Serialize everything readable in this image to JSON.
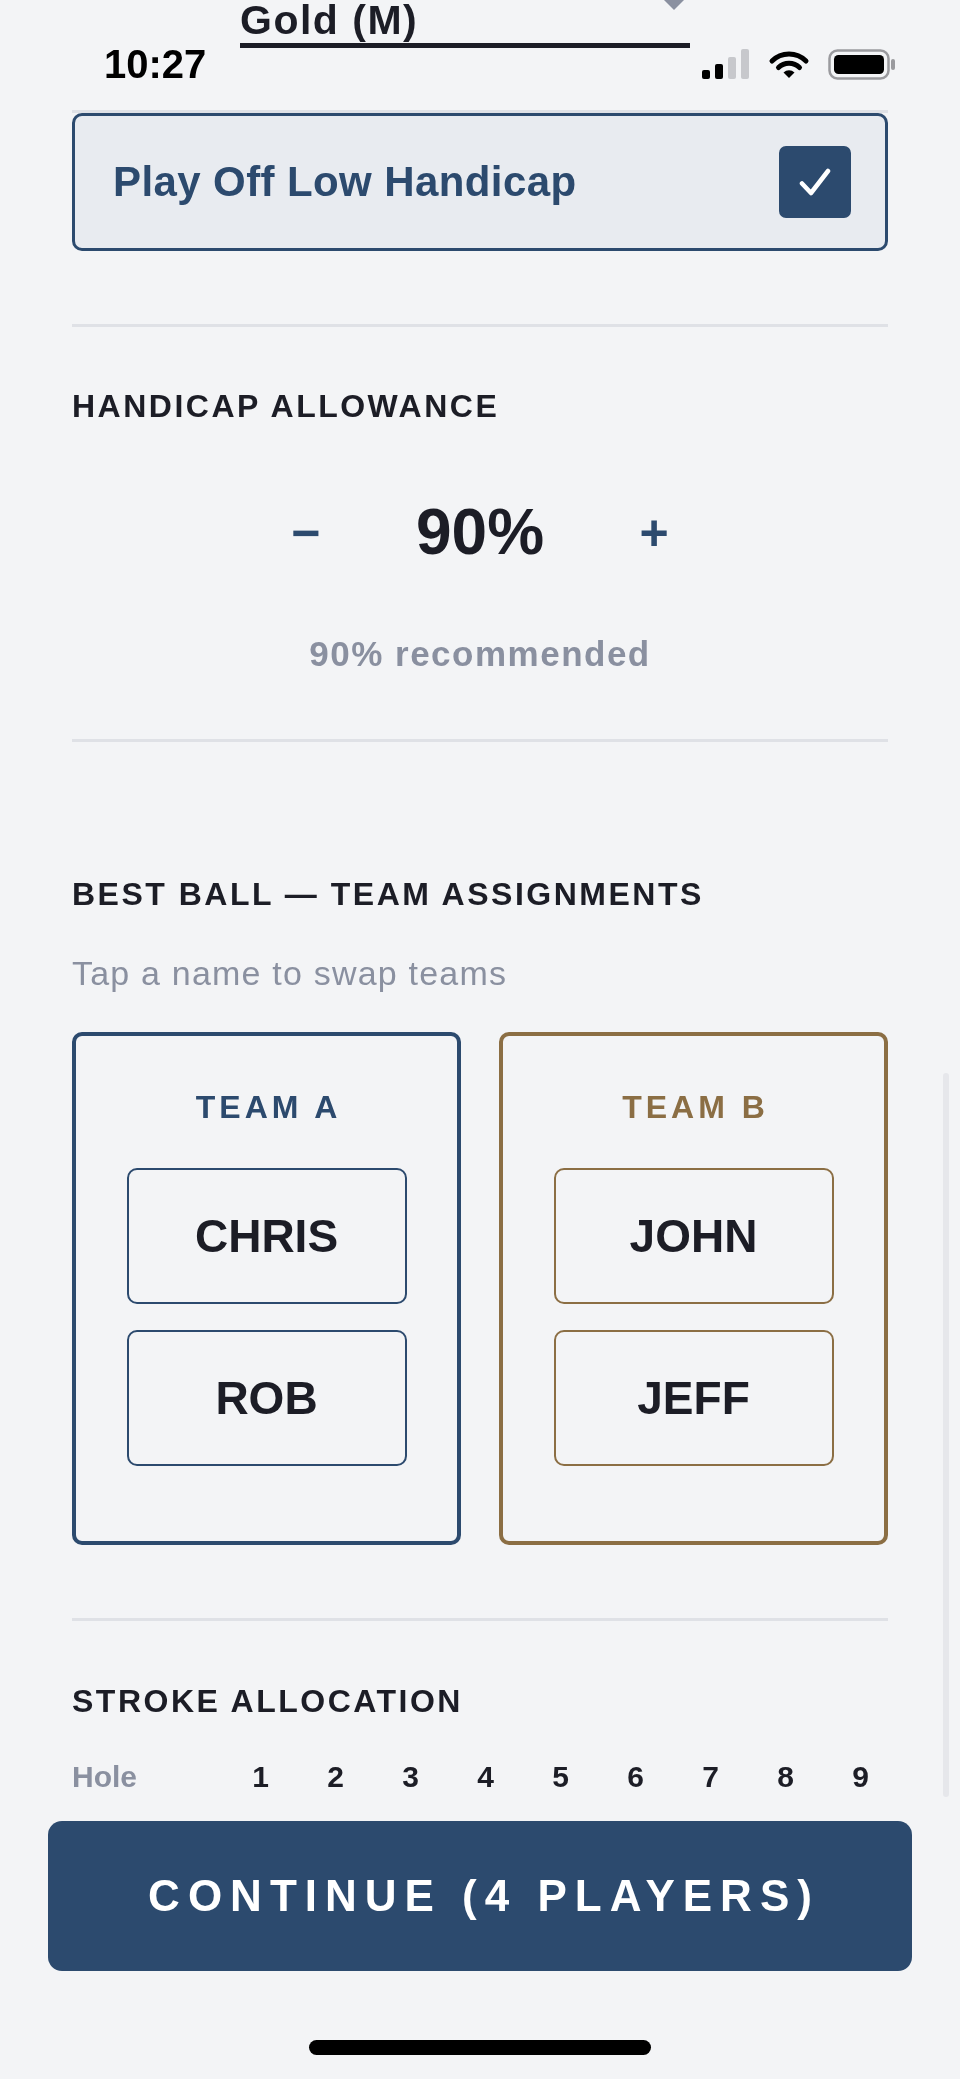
{
  "top_field": {
    "value": "Gold (M)"
  },
  "status_bar": {
    "time": "10:27"
  },
  "play_off_low": {
    "label": "Play Off Low Handicap",
    "checked": true
  },
  "handicap_allowance": {
    "heading": "HANDICAP ALLOWANCE",
    "decrement": "−",
    "value": "90%",
    "increment": "+",
    "note": "90% recommended"
  },
  "teams_section": {
    "heading": "BEST BALL — TEAM ASSIGNMENTS",
    "hint": "Tap a name to swap teams",
    "teams": [
      {
        "name": "TEAM A",
        "color": "#2c4a6e",
        "players": [
          "CHRIS",
          "ROB"
        ]
      },
      {
        "name": "TEAM B",
        "color": "#8b6e44",
        "players": [
          "JOHN",
          "JEFF"
        ]
      }
    ]
  },
  "stroke_allocation": {
    "heading": "STROKE ALLOCATION",
    "row_label": "Hole",
    "holes": [
      "1",
      "2",
      "3",
      "4",
      "5",
      "6",
      "7",
      "8",
      "9"
    ]
  },
  "continue_button": {
    "label": "CONTINUE (4 PLAYERS)"
  }
}
